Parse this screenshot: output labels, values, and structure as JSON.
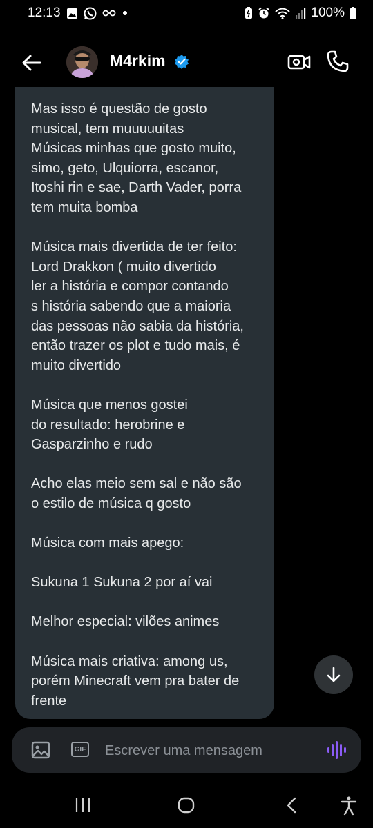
{
  "status_bar": {
    "time": "12:13",
    "battery": "100%",
    "left_icons": [
      "gallery-icon",
      "whatsapp-icon",
      "glasses-icon",
      "dot-icon"
    ],
    "right_icons": [
      "battery-saver-icon",
      "alarm-icon",
      "wifi-icon",
      "signal-icon",
      "battery-icon"
    ]
  },
  "header": {
    "name": "M4rkim",
    "verified": true
  },
  "message": {
    "paragraphs": [
      "Mas isso é questão de gosto\nmusical, tem muuuuuitas\nMúsicas minhas que gosto muito,\nsimo, geto, Ulquiorra, escanor,\nItoshi rin e sae, Darth Vader, porra\ntem muita bomba",
      "Música mais divertida de ter feito:\nLord Drakkon ( muito divertido\nler a história e compor contando\ns história sabendo que a maioria\ndas pessoas não sabia da história,\nentão trazer os plot e tudo mais, é\nmuito divertido",
      "Música que menos gostei\ndo resultado: herobrine e\nGasparzinho e rudo",
      "Acho elas meio sem sal e não são\no estilo de música q gosto",
      "Música com mais apego:",
      "Sukuna 1 Sukuna 2 por aí vai",
      "Melhor especial: vilões animes",
      "Música mais criativa: among us,\nporém Minecraft vem pra bater de\nfrente"
    ]
  },
  "composer": {
    "placeholder": "Escrever uma mensagem",
    "gif_label": "GIF"
  },
  "colors": {
    "background": "#000000",
    "bubble": "#283036",
    "composer": "#202327",
    "verified": "#1d9bf0",
    "voice_accent": "#8b5cf6"
  }
}
